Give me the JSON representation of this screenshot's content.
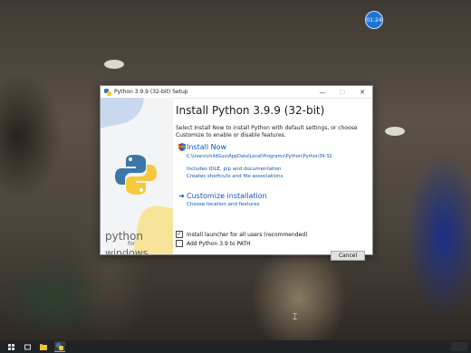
{
  "desktop": {
    "clock_badge": "01:24"
  },
  "dialog": {
    "window_title": "Python 3.9.9 (32-bit) Setup",
    "heading": "Install Python 3.9.9 (32-bit)",
    "subtitle": "Select Install Now to install Python with default settings, or choose Customize to enable or disable features.",
    "install_now": {
      "label": "Install Now",
      "path": "C:\\Users\\childGuo\\AppData\\Local\\Programs\\Python\\Python39-32",
      "desc_line1": "Includes IDLE, pip and documentation",
      "desc_line2": "Creates shortcuts and file associations"
    },
    "customize": {
      "label": "Customize installation",
      "desc": "Choose location and features"
    },
    "checkboxes": [
      {
        "label": "Install launcher for all users (recommended)",
        "checked": true
      },
      {
        "label": "Add Python 3.9 to PATH",
        "checked": false
      }
    ],
    "cancel_label": "Cancel",
    "branding": {
      "word1": "python",
      "word2": "for",
      "word3": "windows"
    },
    "controls": {
      "minimize": "—",
      "maximize": "☐",
      "close": "✕"
    }
  },
  "icons": {
    "shield": "shield-icon",
    "arrow": "arrow-right-icon",
    "python_logo": "python-logo-icon"
  },
  "colors": {
    "link_blue": "#0a55b8",
    "python_blue": "#3b77a8",
    "python_yellow": "#f5c93b",
    "taskbar": "#202225"
  }
}
